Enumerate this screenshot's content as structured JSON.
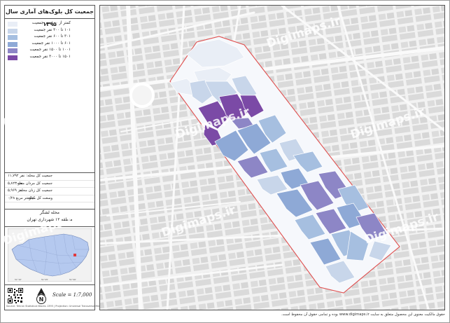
{
  "title": "جمعیت کل بلوک‌های آماری سال ۱۳۹۵",
  "legend": [
    {
      "label": "کمتر از ۱۰۰ نفر جمعیت",
      "color": "#e9eef6"
    },
    {
      "label": "۱۰۱ تا ۳۰۰ نفر جمعیت",
      "color": "#c8d6ea"
    },
    {
      "label": "۳۰۱ تا ۶۰۰ نفر جمعیت",
      "color": "#a6bfe0"
    },
    {
      "label": "۶۰۱ تا ۱۰۰۰ نفر جمعیت",
      "color": "#8ea9d6"
    },
    {
      "label": "۱۰۰۱ تا ۱۵۰۰ نفر جمعیت",
      "color": "#8d86c6"
    },
    {
      "label": "۱۵۰۱ تا ۳۰۰۰ نفر جمعیت",
      "color": "#7b4aa6"
    }
  ],
  "stats": [
    {
      "key": "جمعیت کل محله:",
      "value": "۱۱,۷۹۲ نفر"
    },
    {
      "key": "جمعیت کل مردان محله:",
      "value": "۵,۸۲۳ نفر"
    },
    {
      "key": "جمعیت کل زنان محله:",
      "value": "۵,۹۶۹ نفر"
    },
    {
      "key": "وسعت کل محله:",
      "value": "۰/۲۸ کیلومتر مربع"
    }
  ],
  "location": {
    "neighborhood": "محله لشگر",
    "district": "منطقه ۱۲ شهرداری تهران"
  },
  "scale": "Scale = 1:7,000",
  "north": "N",
  "credit": "Source: Tehran Statistical Blocks 1395 | Projection: Universal Transverse Mercator",
  "watermark": "Digimaps.ir",
  "footer": "حقوق مالکیت معنوی این محصول متعلق به سایت www.digimaps.ir بوده و تمامی حقوق آن محفوظ است.",
  "colors": {
    "background": "#e8e8e8",
    "road": "#f4f4f4",
    "boundary": "#e05050",
    "inset_city": "#b5c9ef"
  }
}
